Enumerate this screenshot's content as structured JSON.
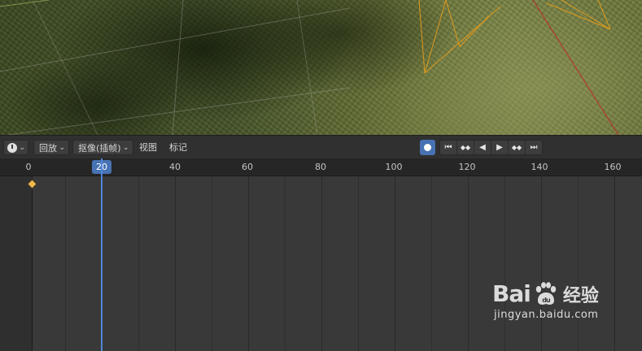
{
  "header": {
    "editor_type_icon": "clock-icon",
    "menus": {
      "playback": "回放",
      "keying": "抠像(插帧)",
      "view": "视图",
      "marker": "标记"
    },
    "record_icon": "record-circle-icon",
    "transport": [
      "jump-to-start-icon",
      "prev-keyframe-icon",
      "play-reverse-icon",
      "play-icon",
      "next-keyframe-icon",
      "jump-to-end-icon"
    ],
    "transport_glyphs": [
      "⏮",
      "◆◆",
      "◀",
      "▶",
      "◆◆",
      "⏭"
    ]
  },
  "ruler": {
    "labels": [
      "0",
      "40",
      "60",
      "80",
      "100",
      "120",
      "140",
      "160"
    ],
    "current_frame": "20"
  },
  "colors": {
    "accent": "#4772b3",
    "keyframe": "#f0b94a",
    "camera_outline": "#e09a1e"
  },
  "watermark": {
    "brand": "Bai",
    "brand2": "du",
    "cn": "经验",
    "url": "jingyan.baidu.com"
  }
}
